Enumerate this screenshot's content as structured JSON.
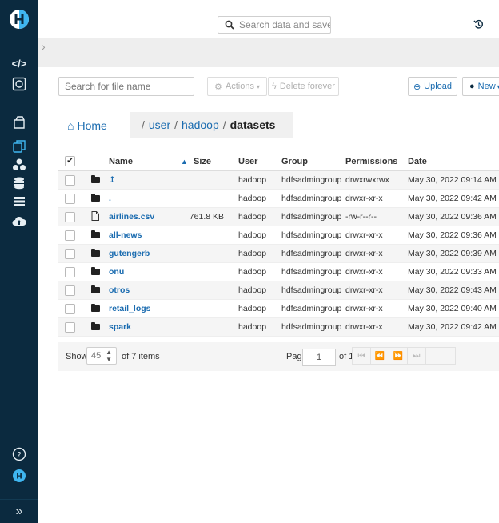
{
  "colors": {
    "sidebar": "#0b2a3f",
    "accent": "#1b6cb0",
    "active_nav": "#3fb6f0"
  },
  "sidebar": {
    "logo_icon": "hue-logo-icon",
    "items": [
      {
        "icon": "editor-code-icon",
        "glyph": "</>"
      },
      {
        "icon": "scheduler-icon"
      },
      {
        "icon": "jobs-icon"
      },
      {
        "icon": "files-icon",
        "active": true
      },
      {
        "icon": "tables-icon"
      },
      {
        "icon": "database-icon"
      },
      {
        "icon": "storage-icon"
      },
      {
        "icon": "cloud-upload-icon"
      },
      {
        "icon": "help-icon"
      },
      {
        "icon": "user-avatar-icon",
        "glyph": "H"
      }
    ],
    "collapse_glyph": "»"
  },
  "topbar": {
    "search_placeholder": "Search data and saved q"
  },
  "toolbar": {
    "file_search_placeholder": "Search for file name",
    "actions_label": "Actions",
    "delete_label": "Delete forever",
    "upload_label": "Upload",
    "new_label": "New"
  },
  "breadcrumb": {
    "home": "Home",
    "segments": [
      "user",
      "hadoop"
    ],
    "current": "datasets"
  },
  "table": {
    "headers": {
      "name": "Name",
      "size": "Size",
      "user": "User",
      "group": "Group",
      "permissions": "Permissions",
      "date": "Date"
    },
    "rows": [
      {
        "type": "folder",
        "name": "↥",
        "size": "",
        "user": "hadoop",
        "group": "hdfsadmingroup",
        "permissions": "drwxrwxrwx",
        "date": "May 30, 2022 09:14 AM"
      },
      {
        "type": "folder",
        "name": ".",
        "size": "",
        "user": "hadoop",
        "group": "hdfsadmingroup",
        "permissions": "drwxr-xr-x",
        "date": "May 30, 2022 09:42 AM"
      },
      {
        "type": "file",
        "name": "airlines.csv",
        "size": "761.8 KB",
        "user": "hadoop",
        "group": "hdfsadmingroup",
        "permissions": "-rw-r--r--",
        "date": "May 30, 2022 09:36 AM"
      },
      {
        "type": "folder",
        "name": "all-news",
        "size": "",
        "user": "hadoop",
        "group": "hdfsadmingroup",
        "permissions": "drwxr-xr-x",
        "date": "May 30, 2022 09:36 AM"
      },
      {
        "type": "folder",
        "name": "gutengerb",
        "size": "",
        "user": "hadoop",
        "group": "hdfsadmingroup",
        "permissions": "drwxr-xr-x",
        "date": "May 30, 2022 09:39 AM"
      },
      {
        "type": "folder",
        "name": "onu",
        "size": "",
        "user": "hadoop",
        "group": "hdfsadmingroup",
        "permissions": "drwxr-xr-x",
        "date": "May 30, 2022 09:33 AM"
      },
      {
        "type": "folder",
        "name": "otros",
        "size": "",
        "user": "hadoop",
        "group": "hdfsadmingroup",
        "permissions": "drwxr-xr-x",
        "date": "May 30, 2022 09:43 AM"
      },
      {
        "type": "folder",
        "name": "retail_logs",
        "size": "",
        "user": "hadoop",
        "group": "hdfsadmingroup",
        "permissions": "drwxr-xr-x",
        "date": "May 30, 2022 09:40 AM"
      },
      {
        "type": "folder",
        "name": "spark",
        "size": "",
        "user": "hadoop",
        "group": "hdfsadmingroup",
        "permissions": "drwxr-xr-x",
        "date": "May 30, 2022 09:42 AM"
      }
    ]
  },
  "footer": {
    "show_label": "Show",
    "page_size": "45",
    "items_label": "of 7 items",
    "page_label": "Page",
    "page_value": "1",
    "of_pages": "of 1"
  }
}
